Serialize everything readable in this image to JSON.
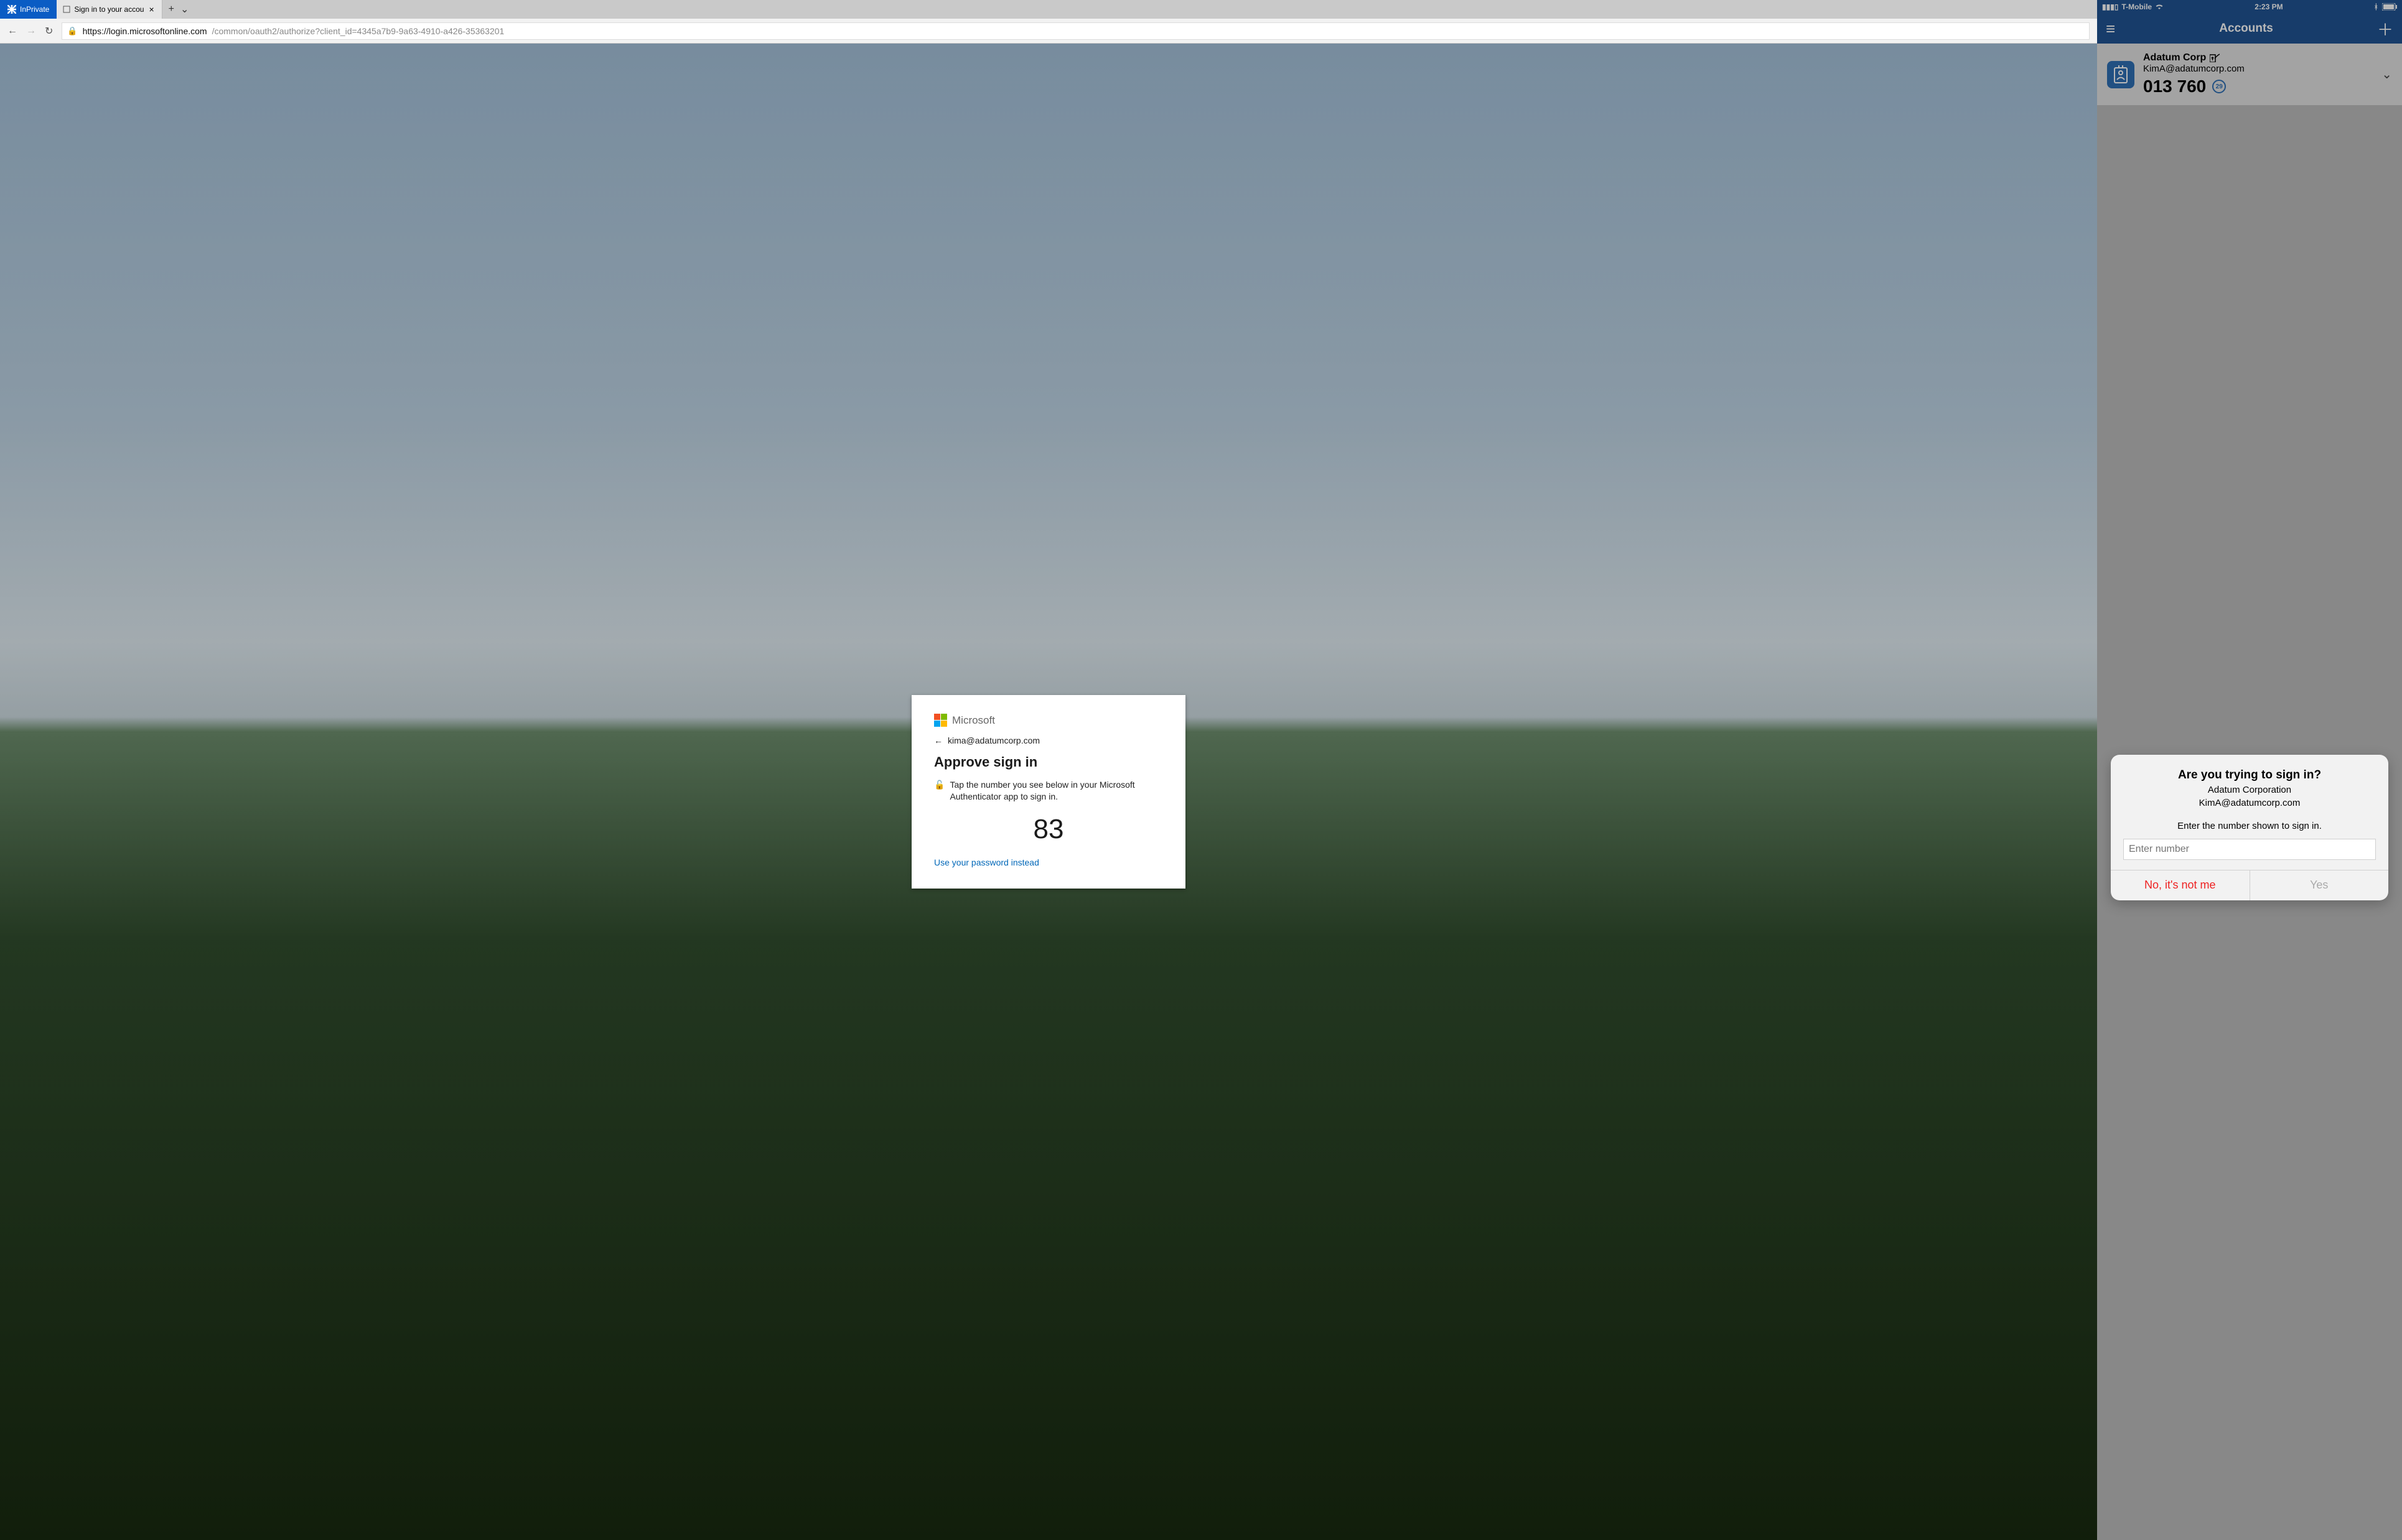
{
  "browser": {
    "inprivate_label": "InPrivate",
    "tab_title": "Sign in to your accou",
    "url_host": "https://login.microsoftonline.com",
    "url_path": "/common/oauth2/authorize?client_id=4345a7b9-9a63-4910-a426-35363201",
    "logo_text": "Microsoft",
    "identity": "kima@adatumcorp.com",
    "card_title": "Approve sign in",
    "instruction": "Tap the number you see below in your Microsoft Authenticator app to sign in.",
    "number": "83",
    "alt_link": "Use your password instead"
  },
  "phone": {
    "carrier": "T-Mobile",
    "clock": "2:23 PM",
    "nav_title": "Accounts",
    "account": {
      "name": "Adatum Corp",
      "email": "KimA@adatumcorp.com",
      "otp": "013 760",
      "timer": "29"
    },
    "alert": {
      "title": "Are you trying to sign in?",
      "org": "Adatum Corporation",
      "email": "KimA@adatumcorp.com",
      "message": "Enter the number shown to sign in.",
      "placeholder": "Enter number",
      "no": "No, it's not me",
      "yes": "Yes"
    }
  }
}
